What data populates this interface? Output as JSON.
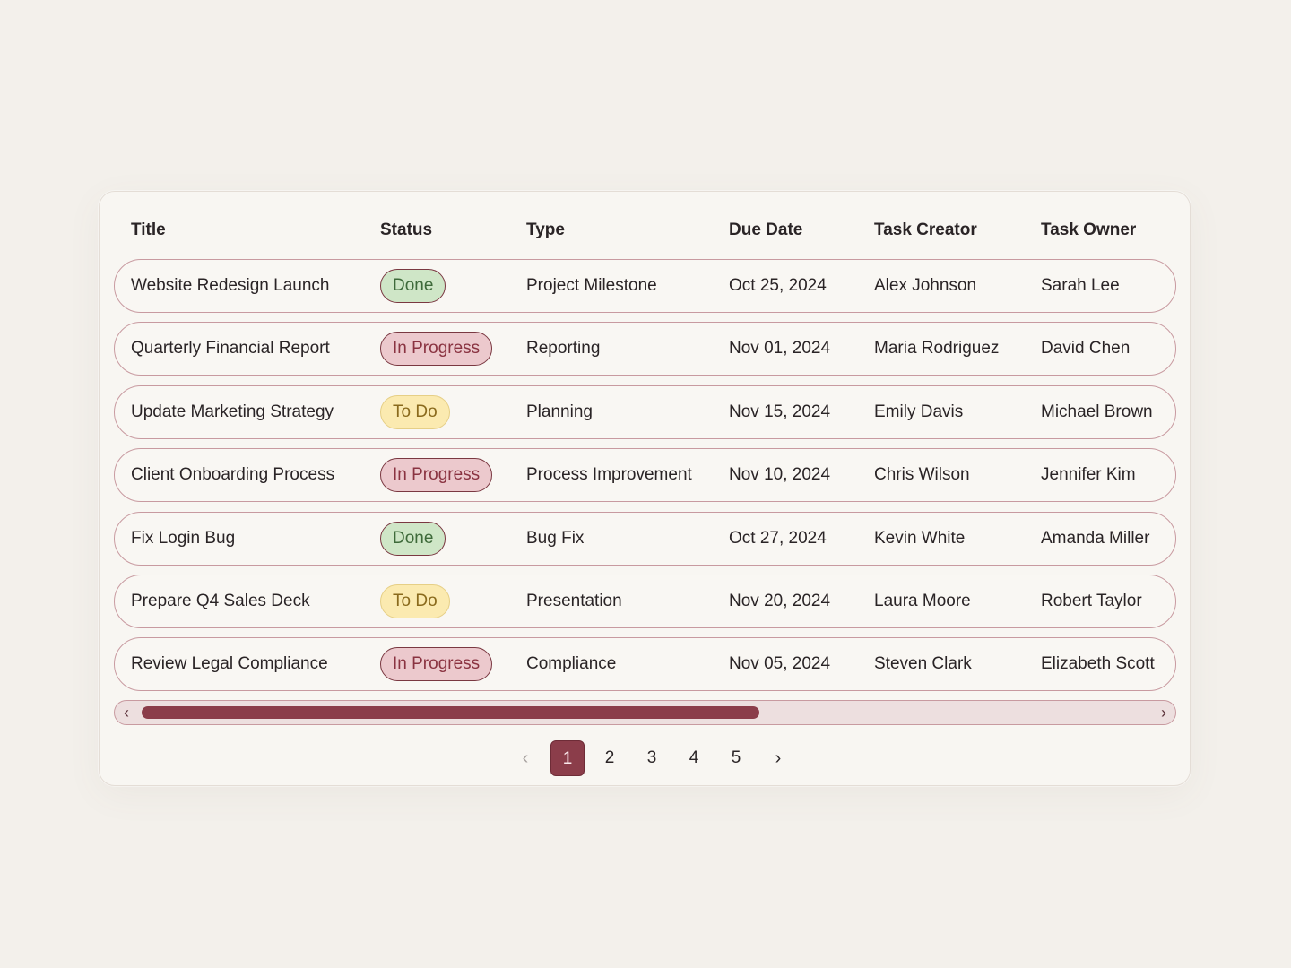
{
  "table": {
    "columns": [
      "Title",
      "Status",
      "Type",
      "Due Date",
      "Task Creator",
      "Task Owner"
    ],
    "rows": [
      {
        "title": "Website Redesign Launch",
        "status": "Done",
        "type": "Project Milestone",
        "due": "Oct 25, 2024",
        "creator": "Alex Johnson",
        "owner": "Sarah Lee"
      },
      {
        "title": "Quarterly Financial Report",
        "status": "In Progress",
        "type": "Reporting",
        "due": "Nov 01, 2024",
        "creator": "Maria Rodriguez",
        "owner": "David Chen"
      },
      {
        "title": "Update Marketing Strategy",
        "status": "To Do",
        "type": "Planning",
        "due": "Nov 15, 2024",
        "creator": "Emily Davis",
        "owner": "Michael Brown"
      },
      {
        "title": "Client Onboarding Process",
        "status": "In Progress",
        "type": "Process Improvement",
        "due": "Nov 10, 2024",
        "creator": "Chris Wilson",
        "owner": "Jennifer Kim"
      },
      {
        "title": "Fix Login Bug",
        "status": "Done",
        "type": "Bug Fix",
        "due": "Oct 27, 2024",
        "creator": "Kevin White",
        "owner": "Amanda Miller"
      },
      {
        "title": "Prepare Q4 Sales Deck",
        "status": "To Do",
        "type": "Presentation",
        "due": "Nov 20, 2024",
        "creator": "Laura Moore",
        "owner": "Robert Taylor"
      },
      {
        "title": "Review Legal Compliance",
        "status": "In Progress",
        "type": "Compliance",
        "due": "Nov 05, 2024",
        "creator": "Steven Clark",
        "owner": "Elizabeth Scott"
      }
    ]
  },
  "status_colors": {
    "Done": {
      "bg": "#cfe6c7",
      "fg": "#3e6a3a"
    },
    "In Progress": {
      "bg": "#ecc9cd",
      "fg": "#8a3341"
    },
    "To Do": {
      "bg": "#fbeab0",
      "fg": "#8a6a1c"
    }
  },
  "scrollbar": {
    "left_arrow": "‹",
    "right_arrow": "›",
    "thumb_fraction": 0.6
  },
  "pagination": {
    "prev": "‹",
    "next": "›",
    "pages": [
      "1",
      "2",
      "3",
      "4",
      "5"
    ],
    "current": "1"
  },
  "colors": {
    "accent": "#8b3d4a",
    "background": "#f3f0eb",
    "card": "#f8f6f2",
    "row_border": "#c89aa0"
  }
}
